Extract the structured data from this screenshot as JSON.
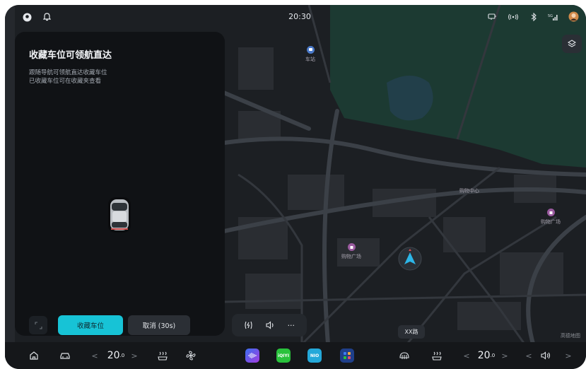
{
  "status_bar": {
    "time": "20:30",
    "left_icons": [
      "profile-icon",
      "bell-icon"
    ],
    "right_icons": [
      "charging-plug-icon",
      "hotspot-icon",
      "bluetooth-icon",
      "cellular-5g-icon",
      "user-avatar-icon"
    ]
  },
  "parking_panel": {
    "title": "收藏车位可领航直达",
    "description_line1": "跟随导航可领航直达收藏车位",
    "description_line2": "已收藏车位可在收藏夹查看",
    "primary_button": "收藏车位",
    "secondary_button": "取消 (30s)"
  },
  "map": {
    "pois": [
      {
        "label": "车站",
        "color": "#4a79c8"
      },
      {
        "label": "购物广场",
        "color": "#9a5a9f"
      },
      {
        "label": "购物中心",
        "color": "#9a5a9f"
      },
      {
        "label": "购物广场",
        "color": "#9a5a9f"
      }
    ],
    "street_label": "XX路",
    "watermark": "高德地图",
    "navigation_arrow_color": "#2db6e8"
  },
  "media_controls": {
    "icons": [
      "lightning-icon",
      "volume-icon",
      "more-icon"
    ],
    "more_label": "···"
  },
  "dock": {
    "left_temp": "20",
    "left_temp_decimal": ".0",
    "right_temp": "20",
    "right_temp_decimal": ".0",
    "arrow_left": "<",
    "arrow_right": ">",
    "apps": [
      {
        "name": "audio-app-icon",
        "color": "#5b3be0"
      },
      {
        "name": "iqiyi-app-icon",
        "color": "#29c23c",
        "label": "iQIYI"
      },
      {
        "name": "nio-app-icon",
        "color": "#24a8d9",
        "label": "NIO"
      },
      {
        "name": "app-grid-icon",
        "color": "#1f5fe0"
      }
    ]
  },
  "colors": {
    "accent": "#17c3d6",
    "panel_bg": "#101215",
    "map_bg": "#1c1f23",
    "park_green": "#1c3a32"
  }
}
